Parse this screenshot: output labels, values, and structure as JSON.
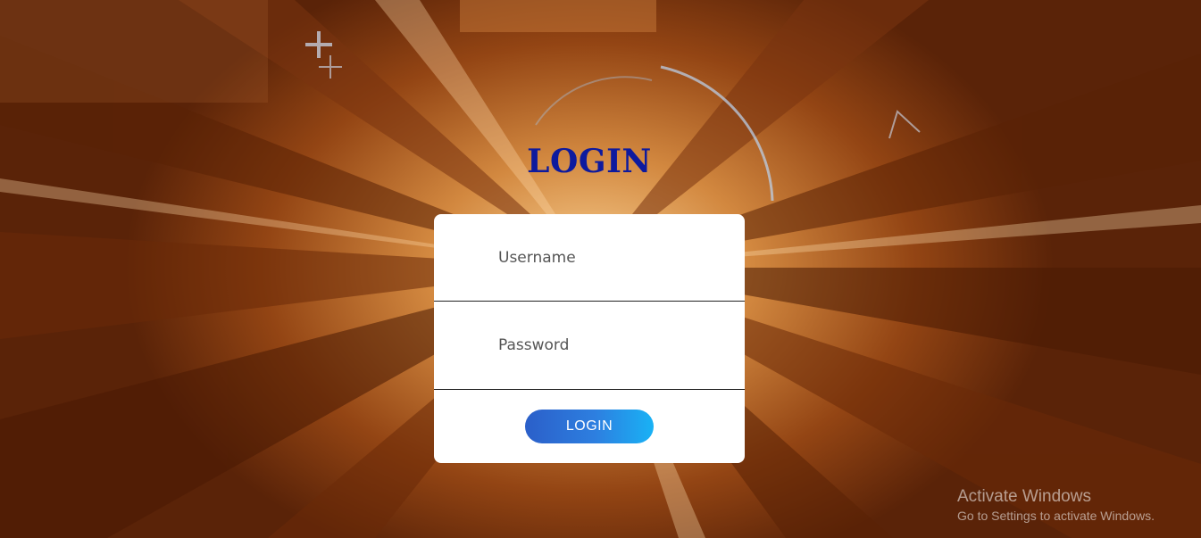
{
  "page": {
    "title": "LOGIN"
  },
  "form": {
    "username_placeholder": "Username",
    "password_placeholder": "Password",
    "submit_label": "LOGIN"
  },
  "watermark": {
    "title": "Activate Windows",
    "subtitle": "Go to Settings to activate Windows."
  },
  "colors": {
    "title": "#0d1a9e",
    "button_start": "#2b5fc9",
    "button_end": "#19b2f5",
    "card": "#ffffff"
  }
}
